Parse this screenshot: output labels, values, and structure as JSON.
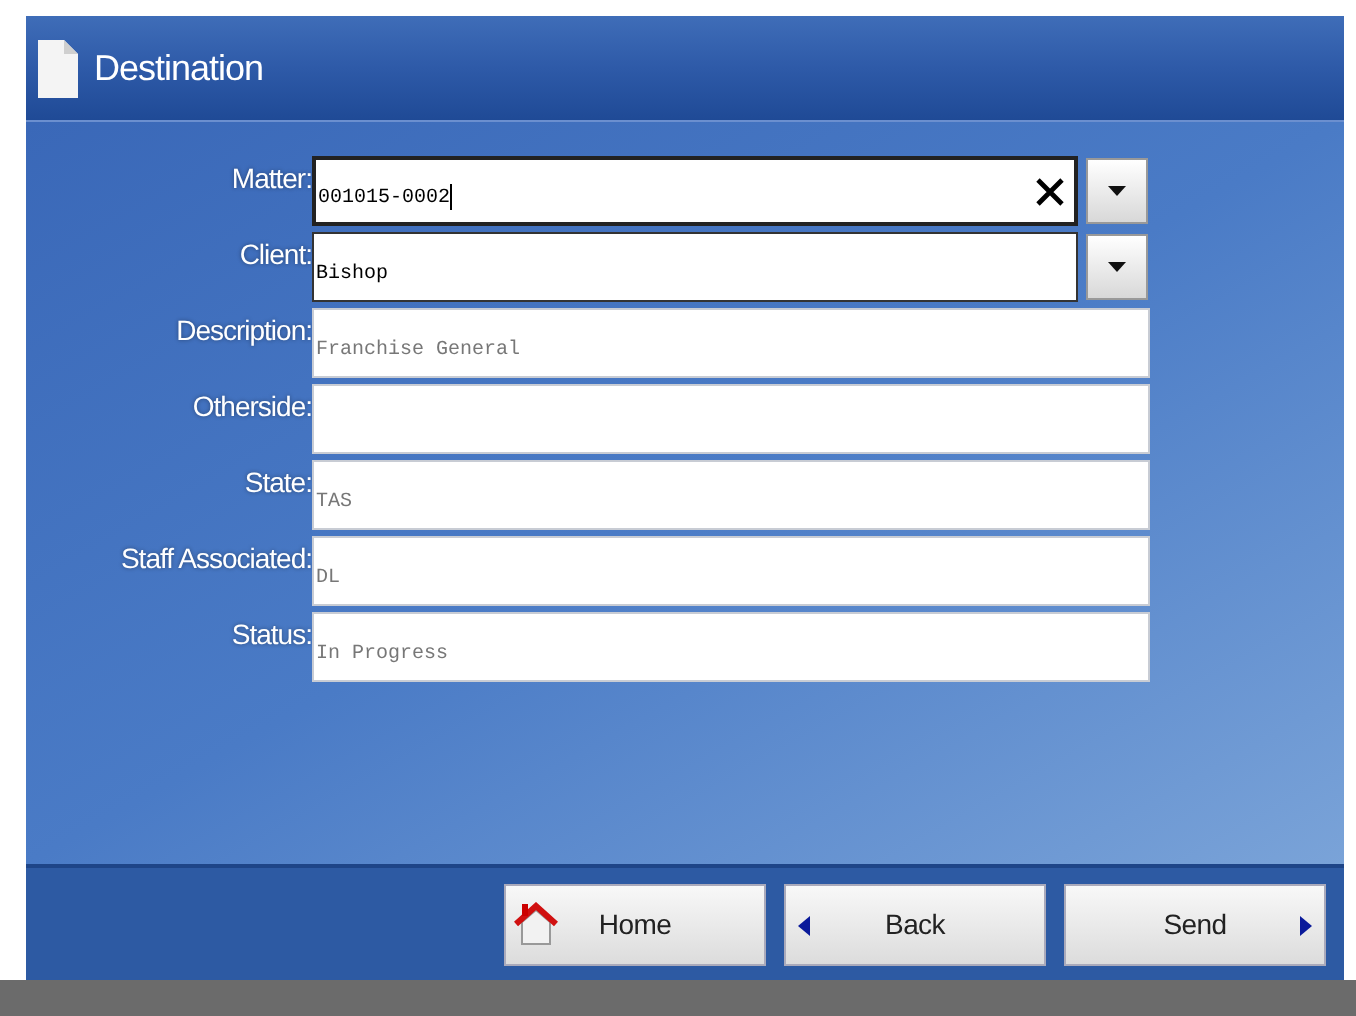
{
  "window": {
    "title": "Destination"
  },
  "fields": [
    {
      "label": "Matter:",
      "value": "001015-0002",
      "kind": "combo",
      "clearable": true,
      "focused": true,
      "disabled": false
    },
    {
      "label": "Client:",
      "value": "Bishop",
      "kind": "combo",
      "clearable": false,
      "focused": false,
      "disabled": false
    },
    {
      "label": "Description:",
      "value": "Franchise General",
      "kind": "text",
      "clearable": false,
      "focused": false,
      "disabled": true
    },
    {
      "label": "Otherside:",
      "kind": "text",
      "clearable": false,
      "focused": false,
      "disabled": true
    },
    {
      "label": "State:",
      "value": "TAS",
      "kind": "text",
      "clearable": false,
      "focused": false,
      "disabled": true
    },
    {
      "label": "Staff Associated:",
      "value": "DL",
      "kind": "text",
      "clearable": false,
      "focused": false,
      "disabled": true
    },
    {
      "label": "Status:",
      "value": "In Progress",
      "kind": "text",
      "clearable": false,
      "focused": false,
      "disabled": true
    }
  ],
  "buttons": [
    {
      "label": "Home",
      "kind": "home"
    },
    {
      "label": "Back",
      "kind": "back"
    },
    {
      "label": "Send",
      "kind": "send"
    }
  ]
}
